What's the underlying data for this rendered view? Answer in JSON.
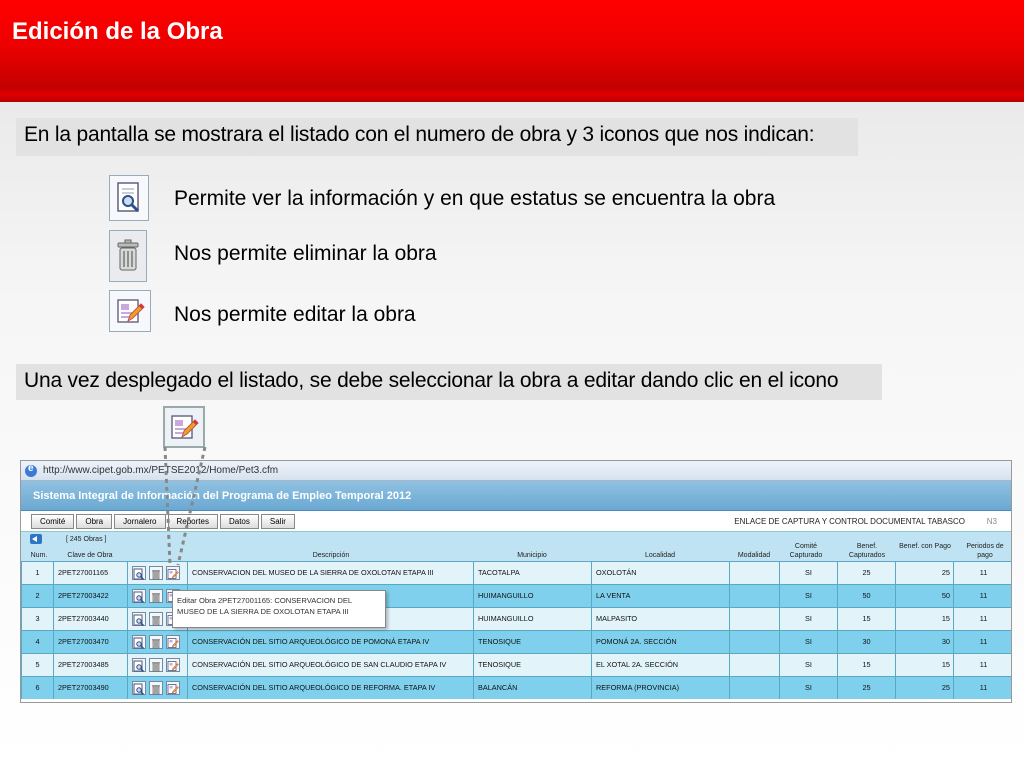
{
  "slide_title": "Edición de la Obra",
  "intro_text": "En la pantalla se mostrara el listado con el numero de obra y 3 iconos que nos indican:",
  "icon_legend": [
    {
      "icon": "view-magnifier-icon",
      "text": "Permite ver la información y en que estatus se encuentra la obra"
    },
    {
      "icon": "trash-icon",
      "text": "Nos permite eliminar la obra"
    },
    {
      "icon": "edit-pencil-icon",
      "text": "Nos permite editar la obra"
    }
  ],
  "instruction_text": "Una vez desplegado el listado, se debe seleccionar la obra a editar dando clic en el icono",
  "browser": {
    "url": "http://www.cipet.gob.mx/PETSE2012/Home/Pet3.cfm",
    "app_title": "Sistema Integral de Información del Programa de Empleo Temporal 2012",
    "menu": [
      "Comité",
      "Obra",
      "Jornalero",
      "Reportes",
      "Datos",
      "Salir"
    ],
    "enlace": "ENLACE DE CAPTURA Y CONTROL DOCUMENTAL TABASCO",
    "level": "N3",
    "count_label": "[ 245 Obras ]",
    "columns": {
      "num": "Num.",
      "clave": "Clave de Obra",
      "descripcion": "Descripción",
      "municipio": "Municipio",
      "localidad": "Localidad",
      "modalidad": "Modalidad",
      "comite": "Comité Capturado",
      "benef": "Benef. Capturados",
      "benef_pago": "Benef. con Pago",
      "periodos": "Periodos de pago"
    },
    "rows": [
      {
        "num": "1",
        "clave": "2PET27001165",
        "descripcion": "CONSERVACION DEL MUSEO DE LA SIERRA DE OXOLOTAN ETAPA III",
        "municipio": "TACOTALPA",
        "localidad": "OXOLOTÁN",
        "modalidad": "",
        "comite": "SI",
        "benef": "25",
        "benef_pago": "25",
        "periodos": "11"
      },
      {
        "num": "2",
        "clave": "2PET27003422",
        "descripcion": "ETAPA IV",
        "municipio": "HUIMANGUILLO",
        "localidad": "LA VENTA",
        "modalidad": "",
        "comite": "SI",
        "benef": "50",
        "benef_pago": "50",
        "periodos": "11"
      },
      {
        "num": "3",
        "clave": "2PET27003440",
        "descripcion": "SITO. ETAPA IV",
        "municipio": "HUIMANGUILLO",
        "localidad": "MALPASITO",
        "modalidad": "",
        "comite": "SI",
        "benef": "15",
        "benef_pago": "15",
        "periodos": "11"
      },
      {
        "num": "4",
        "clave": "2PET27003470",
        "descripcion": "CONSERVACIÓN DEL SITIO ARQUEOLÓGICO DE POMONÁ ETAPA IV",
        "municipio": "TENOSIQUE",
        "localidad": "POMONÁ 2A. SECCIÓN",
        "modalidad": "",
        "comite": "SI",
        "benef": "30",
        "benef_pago": "30",
        "periodos": "11"
      },
      {
        "num": "5",
        "clave": "2PET27003485",
        "descripcion": "CONSERVACIÓN DEL SITIO ARQUEOLÓGICO DE SAN CLAUDIO ETAPA IV",
        "municipio": "TENOSIQUE",
        "localidad": "EL XOTAL 2A. SECCIÓN",
        "modalidad": "",
        "comite": "SI",
        "benef": "15",
        "benef_pago": "15",
        "periodos": "11"
      },
      {
        "num": "6",
        "clave": "2PET27003490",
        "descripcion": "CONSERVACIÓN DEL SITIO ARQUEOLÓGICO DE REFORMA. ETAPA IV",
        "municipio": "BALANCÁN",
        "localidad": "REFORMA (PROVINCIA)",
        "modalidad": "",
        "comite": "SI",
        "benef": "25",
        "benef_pago": "25",
        "periodos": "11"
      }
    ],
    "tooltip": "Editar Obra 2PET27001165: CONSERVACION DEL MUSEO DE LA SIERRA DE OXOLOTAN ETAPA III"
  },
  "colors": {
    "banner_red": "#ee0000",
    "row_light": "#e2f4fa",
    "row_dark": "#7fd0ec",
    "header_blue": "#6aa8d2"
  }
}
